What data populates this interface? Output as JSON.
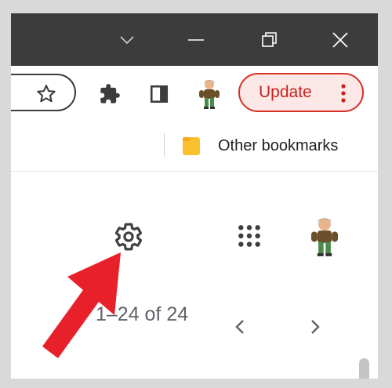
{
  "colors": {
    "titlebar": "#3c3c3c",
    "update_accent": "#d93025",
    "update_fill": "#fce8e6",
    "arrow": "#e8202a",
    "folder": "#fbc02d"
  },
  "window_controls": {
    "icons": [
      "chevron-down-icon",
      "minimize-icon",
      "restore-icon",
      "close-icon"
    ]
  },
  "toolbar": {
    "update_label": "Update",
    "icons": [
      "star-icon",
      "extensions-puzzle-icon",
      "side-panel-icon",
      "profile-avatar-icon",
      "more-menu-icon"
    ]
  },
  "bookmarks": {
    "other_bookmarks_label": "Other bookmarks"
  },
  "page": {
    "pagination_text": "1–24 of 24",
    "icons": [
      "settings-gear-icon",
      "apps-grid-icon",
      "account-avatar-icon",
      "chevron-left-icon",
      "chevron-right-icon"
    ]
  },
  "annotation": {
    "arrow_target": "settings-gear-icon"
  }
}
